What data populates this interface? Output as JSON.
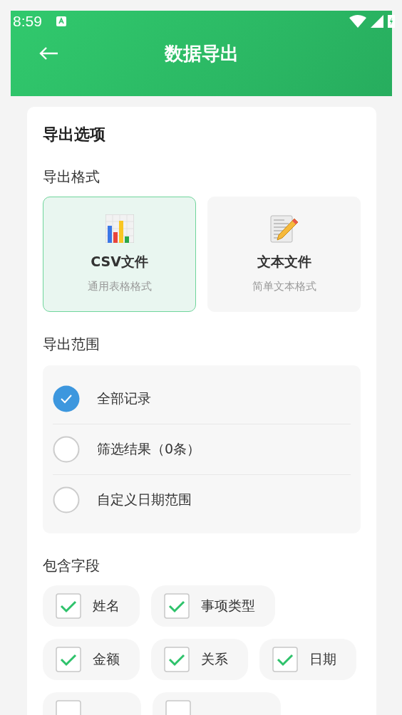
{
  "status_bar": {
    "time": "8:59"
  },
  "header": {
    "title": "数据导出"
  },
  "card": {
    "title": "导出选项",
    "format": {
      "label": "导出格式",
      "options": [
        {
          "kind": "chart",
          "name": "CSV文件",
          "desc": "通用表格格式",
          "selected": true
        },
        {
          "kind": "text",
          "name": "文本文件",
          "desc": "简单文本格式",
          "selected": false
        }
      ]
    },
    "range": {
      "label": "导出范围",
      "options": [
        {
          "label": "全部记录",
          "selected": true
        },
        {
          "label": "筛选结果（0条）",
          "selected": false
        },
        {
          "label": "自定义日期范围",
          "selected": false
        }
      ]
    },
    "fields": {
      "label": "包含字段",
      "rows": [
        [
          {
            "label": "姓名",
            "checked": true
          },
          {
            "label": "事项类型",
            "checked": true
          }
        ],
        [
          {
            "label": "金额",
            "checked": true
          },
          {
            "label": "关系",
            "checked": true
          },
          {
            "label": "日期",
            "checked": true
          }
        ],
        [
          {
            "kind": "cut",
            "checked": false
          },
          {
            "kind": "cut",
            "checked": false
          }
        ]
      ]
    }
  }
}
